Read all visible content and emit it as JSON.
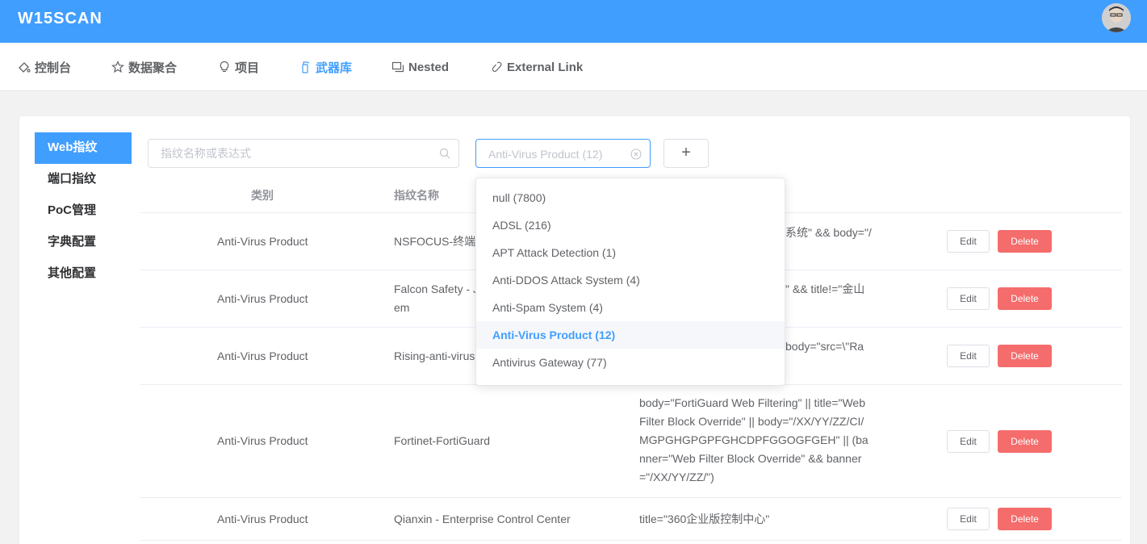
{
  "app": {
    "brand": "W15SCAN"
  },
  "nav": {
    "items": [
      {
        "label": "控制台",
        "icon": "palette-icon"
      },
      {
        "label": "数据聚合",
        "icon": "star-icon"
      },
      {
        "label": "项目",
        "icon": "lightbulb-icon"
      },
      {
        "label": "武器库",
        "icon": "extinguisher-icon"
      },
      {
        "label": "Nested",
        "icon": "copy-icon"
      },
      {
        "label": "External Link",
        "icon": "link-icon"
      }
    ],
    "active": "武器库"
  },
  "sidebar": {
    "items": [
      {
        "label": "Web指纹"
      },
      {
        "label": "端口指纹"
      },
      {
        "label": "PoC管理"
      },
      {
        "label": "字典配置"
      },
      {
        "label": "其他配置"
      }
    ],
    "active": "Web指纹"
  },
  "search": {
    "placeholder": "指纹名称或表达式",
    "value": ""
  },
  "filter": {
    "selected": "Anti-Virus Product (12)"
  },
  "add": {
    "label": "+"
  },
  "table": {
    "headers": [
      "类别",
      "指纹名称"
    ],
    "rows": [
      {
        "category": "Anti-Virus Product",
        "name": "NSFOCUS-终端",
        "rule": "系统\" && body=\"/",
        "edit": "Edit",
        "delete": "Delete"
      },
      {
        "category": "Anti-Virus Product",
        "name": "Falcon Safety - J",
        "name2": "em",
        "rule": "\" && title!=\"金山",
        "edit": "Edit",
        "delete": "Delete"
      },
      {
        "category": "Anti-Virus Product",
        "name": "Rising-anti-virus",
        "rule": "body=\"src=\\\"Ra",
        "edit": "Edit",
        "delete": "Delete"
      },
      {
        "category": "Anti-Virus Product",
        "name": "Fortinet-FortiGuard",
        "rule_lines": [
          "body=\"FortiGuard Web Filtering\" || title=\"Web",
          "Filter Block Override\" || body=\"/XX/YY/ZZ/CI/",
          "MGPGHGPGPFGHCDPFGGOGFGEH\" || (ba",
          "nner=\"Web Filter Block Override\" && banner",
          "=\"/XX/YY/ZZ/\")"
        ],
        "edit": "Edit",
        "delete": "Delete"
      },
      {
        "category": "Anti-Virus Product",
        "name": "Qianxin - Enterprise Control Center",
        "rule": "title=\"360企业版控制中心\"",
        "edit": "Edit",
        "delete": "Delete"
      }
    ]
  },
  "dropdown": {
    "options": [
      {
        "label": "null (7800)"
      },
      {
        "label": "ADSL (216)"
      },
      {
        "label": "APT Attack Detection (1)"
      },
      {
        "label": "Anti-DDOS Attack System (4)"
      },
      {
        "label": "Anti-Spam System (4)"
      },
      {
        "label": "Anti-Virus Product (12)",
        "selected": true
      },
      {
        "label": "Antivirus Gateway (77)"
      }
    ]
  },
  "colors": {
    "primary": "#409eff",
    "danger": "#f56c6c",
    "text": "#606266"
  }
}
